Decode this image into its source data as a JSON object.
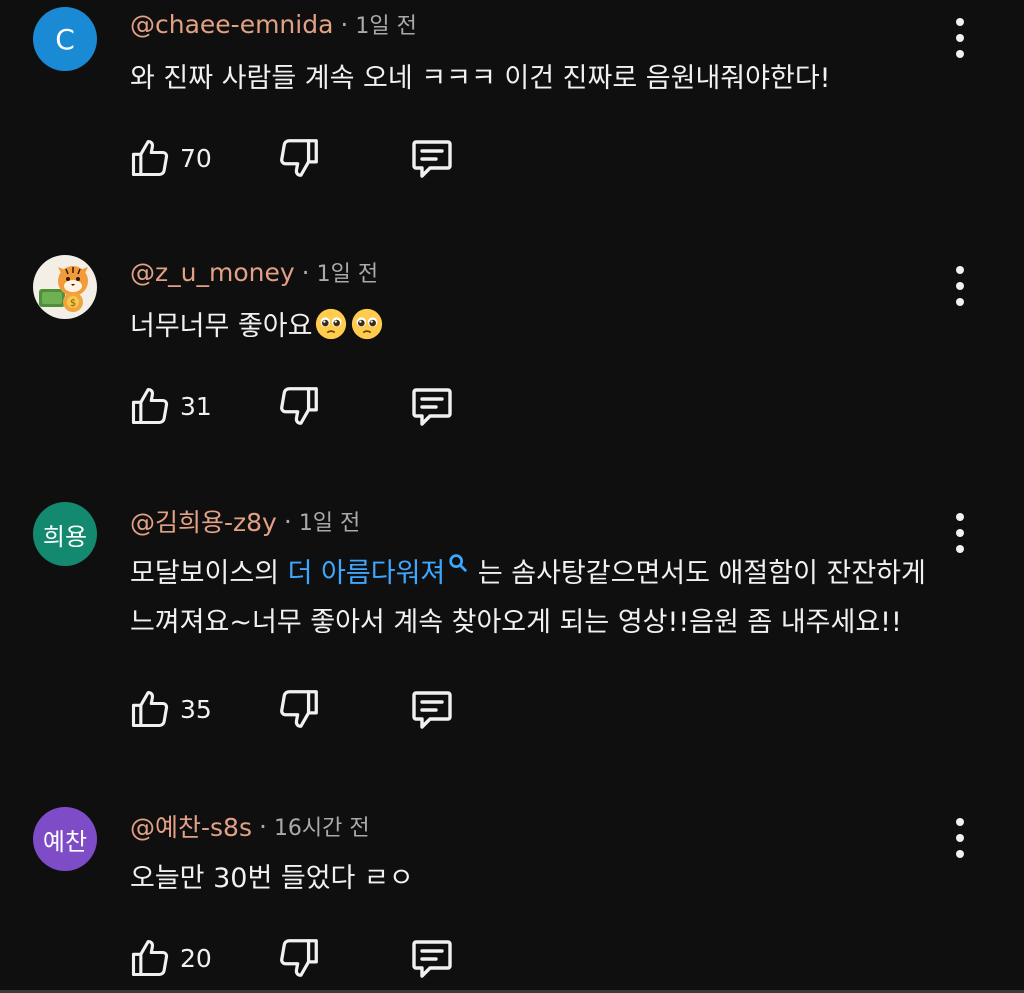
{
  "comments": [
    {
      "avatar": {
        "type": "letter",
        "text": "C",
        "color": "#1a8ad4"
      },
      "handle": "@chaee-emnida",
      "time": "1일 전",
      "text_parts": [
        {
          "t": "와 진짜 사람들 계속 오네 ㅋㅋㅋ 이건 진짜로 음원내줘야한다!"
        }
      ],
      "likes": "70"
    },
    {
      "avatar": {
        "type": "image",
        "icon": "tiger-money-avatar"
      },
      "handle": "@z_u_money",
      "time": "1일 전",
      "text_parts": [
        {
          "t": "너무너무 좋아요"
        }
      ],
      "emojis": [
        "pleading-face-emoji",
        "pleading-face-emoji"
      ],
      "likes": "31"
    },
    {
      "avatar": {
        "type": "letter",
        "text": "희용",
        "color": "#13896f"
      },
      "handle": "@김희용-z8y",
      "time": "1일 전",
      "line1_before": "모달보이스의 ",
      "link": "더 아름다워져",
      "line1_after": " 는 솜사탕같으면서도 애절함이 잔잔하게",
      "line2": "느껴져요~너무 좋아서 계속 찾아오게 되는 영상!!음원 좀 내주세요!!",
      "likes": "35"
    },
    {
      "avatar": {
        "type": "letter",
        "text": "예찬",
        "color": "#7e4cc6"
      },
      "handle": "@예찬-s8s",
      "time": "16시간 전",
      "text_parts": [
        {
          "t": "오늘만 30번 들었다 ㄹㅇ"
        }
      ],
      "likes": "20"
    }
  ],
  "colors": {
    "background": "#0f0f0f",
    "handle": "#e2a085",
    "link": "#3ea6ff",
    "meta": "#aaaaaa"
  }
}
